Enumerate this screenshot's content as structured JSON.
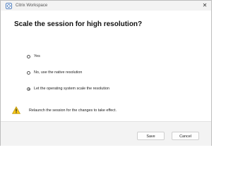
{
  "window": {
    "title": "Citrix Workspace",
    "close_glyph": "✕",
    "app_icon": "citrix-icon"
  },
  "dialog": {
    "heading": "Scale the session for high resolution?",
    "options": [
      {
        "label": "Yes",
        "selected": false
      },
      {
        "label": "No, use the native resolution",
        "selected": false
      },
      {
        "label": "Let the operating system scale the resolution",
        "selected": true
      }
    ],
    "warning": {
      "icon": "warning-icon",
      "text": "Relaunch the session for the changes to take effect."
    }
  },
  "footer": {
    "save_label": "Save",
    "cancel_label": "Cancel"
  },
  "colors": {
    "warning_fill": "#f5c518",
    "titlebar_bg": "#f3f3f3"
  }
}
